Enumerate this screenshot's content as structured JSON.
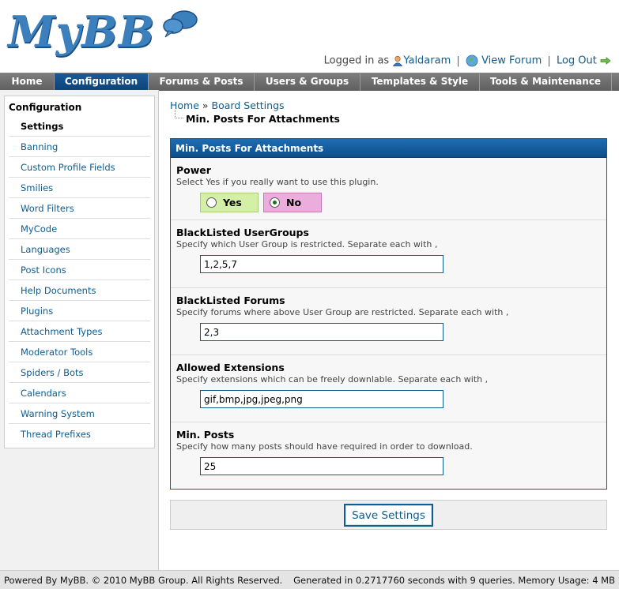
{
  "header": {
    "logo_text": "MyBB",
    "logged_in_as": "Logged in as",
    "username": "Yaldaram",
    "view_forum": "View Forum",
    "logout": "Log Out"
  },
  "menu": {
    "tabs": [
      {
        "label": "Home"
      },
      {
        "label": "Configuration"
      },
      {
        "label": "Forums & Posts"
      },
      {
        "label": "Users & Groups"
      },
      {
        "label": "Templates & Style"
      },
      {
        "label": "Tools & Maintenance"
      }
    ]
  },
  "sidebar": {
    "title": "Configuration",
    "items": [
      {
        "label": "Settings"
      },
      {
        "label": "Banning"
      },
      {
        "label": "Custom Profile Fields"
      },
      {
        "label": "Smilies"
      },
      {
        "label": "Word Filters"
      },
      {
        "label": "MyCode"
      },
      {
        "label": "Languages"
      },
      {
        "label": "Post Icons"
      },
      {
        "label": "Help Documents"
      },
      {
        "label": "Plugins"
      },
      {
        "label": "Attachment Types"
      },
      {
        "label": "Moderator Tools"
      },
      {
        "label": "Spiders / Bots"
      },
      {
        "label": "Calendars"
      },
      {
        "label": "Warning System"
      },
      {
        "label": "Thread Prefixes"
      }
    ]
  },
  "breadcrumb": {
    "home": "Home",
    "sep": "»",
    "board_settings": "Board Settings"
  },
  "page_title": "Min. Posts For Attachments",
  "settings_box": {
    "header": "Min. Posts For Attachments",
    "power": {
      "title": "Power",
      "desc": "Select Yes if you really want to use this plugin.",
      "yes_label": "Yes",
      "no_label": "No",
      "selected": "No"
    },
    "blacklisted_usergroups": {
      "title": "BlackListed UserGroups",
      "desc": "Specify which User Group is restricted. Separate each with ,",
      "value": "1,2,5,7"
    },
    "blacklisted_forums": {
      "title": "BlackListed Forums",
      "desc": "Specify forums where above User Group are restricted. Separate each with ,",
      "value": "2,3"
    },
    "allowed_extensions": {
      "title": "Allowed Extensions",
      "desc": "Specify extensions which can be freely downlable. Separate each with ,",
      "value": "gif,bmp,jpg,jpeg,png"
    },
    "min_posts": {
      "title": "Min. Posts",
      "desc": "Specify how many posts should have required in order to download.",
      "value": "25"
    }
  },
  "save_label": "Save Settings",
  "footer": {
    "left": "Powered By MyBB. © 2010 MyBB Group. All Rights Reserved.",
    "right": "Generated in 0.2717760 seconds with 9 queries. Memory Usage: 4 MB"
  },
  "colors": {
    "accent": "#0f5c8e",
    "menu_active": "#0d4277",
    "yes_bg": "#d4f0a7",
    "no_bg": "#ebaedc"
  },
  "icons": {
    "user": "user-icon",
    "forum": "globe-icon",
    "logout": "arrow-right-icon",
    "logo_bubble": "speech-bubble-icon"
  }
}
